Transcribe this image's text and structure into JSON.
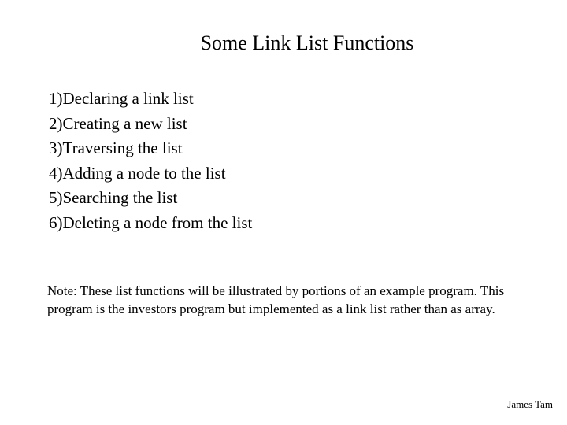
{
  "title": "Some Link List Functions",
  "items": [
    "1)Declaring a link list",
    "2)Creating a new list",
    "3)Traversing the list",
    "4)Adding a node to the list",
    "5)Searching the list",
    "6)Deleting a node from the list"
  ],
  "note": "Note:  These list functions will be illustrated by portions of an example program.  This program is the investors program but implemented as a link list rather than as array.",
  "footer": "James Tam"
}
